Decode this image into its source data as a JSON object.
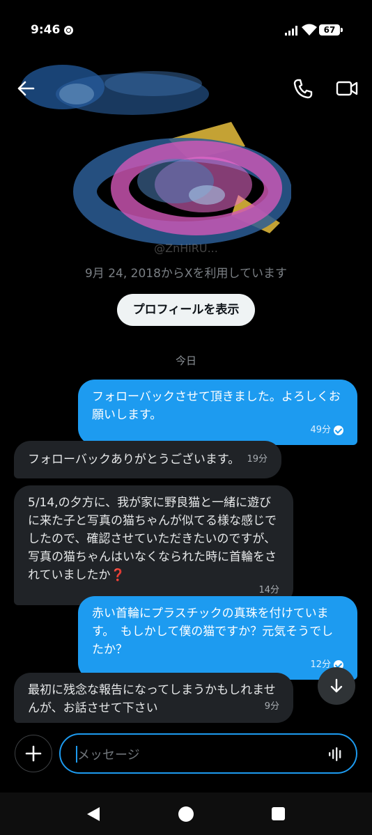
{
  "status_bar": {
    "time": "9:46",
    "battery": "67"
  },
  "profile": {
    "handle": "@ZnHiRU...",
    "since": "9月 24, 2018からXを利用しています",
    "view_profile_label": "プロフィールを表示"
  },
  "date_divider": "今日",
  "messages": [
    {
      "direction": "out",
      "text": "フォローバックさせて頂きました。よろしくお願いします。",
      "time": "49分",
      "read": true
    },
    {
      "direction": "in",
      "text": "フォローバックありがとうございます。",
      "time": "19分"
    },
    {
      "direction": "in",
      "text": "5/14,の夕方に、我が家に野良猫と一緒に遊びに来た子と写真の猫ちゃんが似てる様な感じでしたので、確認させていただきたいのですが、写真の猫ちゃんはいなくなられた時に首輪をされていましたか❓",
      "time": "14分"
    },
    {
      "direction": "out",
      "text": "赤い首輪にプラスチックの真珠を付けています。　もしかして僕の猫ですか？元気そうでしたか？",
      "time": "12分",
      "read": true
    },
    {
      "direction": "in",
      "text": "最初に残念な報告になってしまうかもしれませんが、お話させて下さい",
      "time": "9分"
    }
  ],
  "composer": {
    "placeholder": "メッセージ"
  },
  "colors": {
    "accent": "#1d9bf0",
    "incoming_bubble": "#202327",
    "background": "#000000"
  }
}
